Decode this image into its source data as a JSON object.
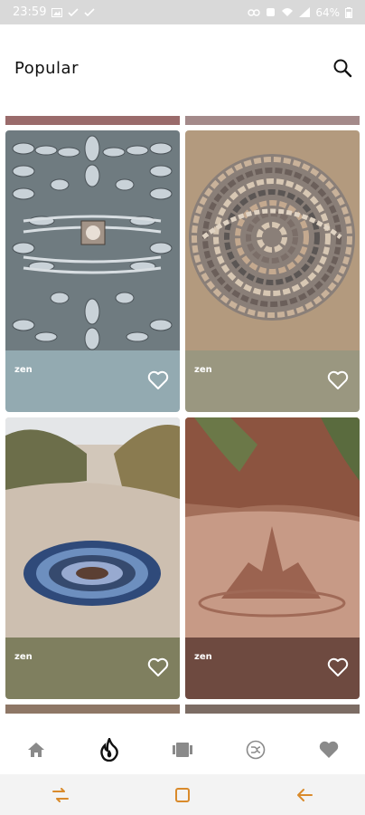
{
  "status_bar": {
    "time": "23:59",
    "battery": "64%"
  },
  "header": {
    "title": "Popular"
  },
  "cards": [
    {
      "label": "zen",
      "bar_color": "#93aab1",
      "theme": "mandala-stones"
    },
    {
      "label": "zen",
      "bar_color": "#9a9780",
      "theme": "spiral-pebbles"
    },
    {
      "label": "zen",
      "bar_color": "#7f7f5f",
      "theme": "beach-circle"
    },
    {
      "label": "zen",
      "bar_color": "#6e4a40",
      "theme": "sand-castle"
    }
  ],
  "top_strips": [
    {
      "color": "#9a6b6b"
    },
    {
      "color": "#a48a8a"
    }
  ],
  "bottom_nav": {
    "items": [
      {
        "icon": "home-icon",
        "active": false
      },
      {
        "icon": "flame-icon",
        "active": true
      },
      {
        "icon": "gallery-icon",
        "active": false
      },
      {
        "icon": "shuffle-icon",
        "active": false
      },
      {
        "icon": "heart-icon",
        "active": false
      }
    ]
  },
  "colors": {
    "accent": "#d98a2b",
    "nav_icon": "#8a8a8a",
    "nav_active": "#111111"
  }
}
